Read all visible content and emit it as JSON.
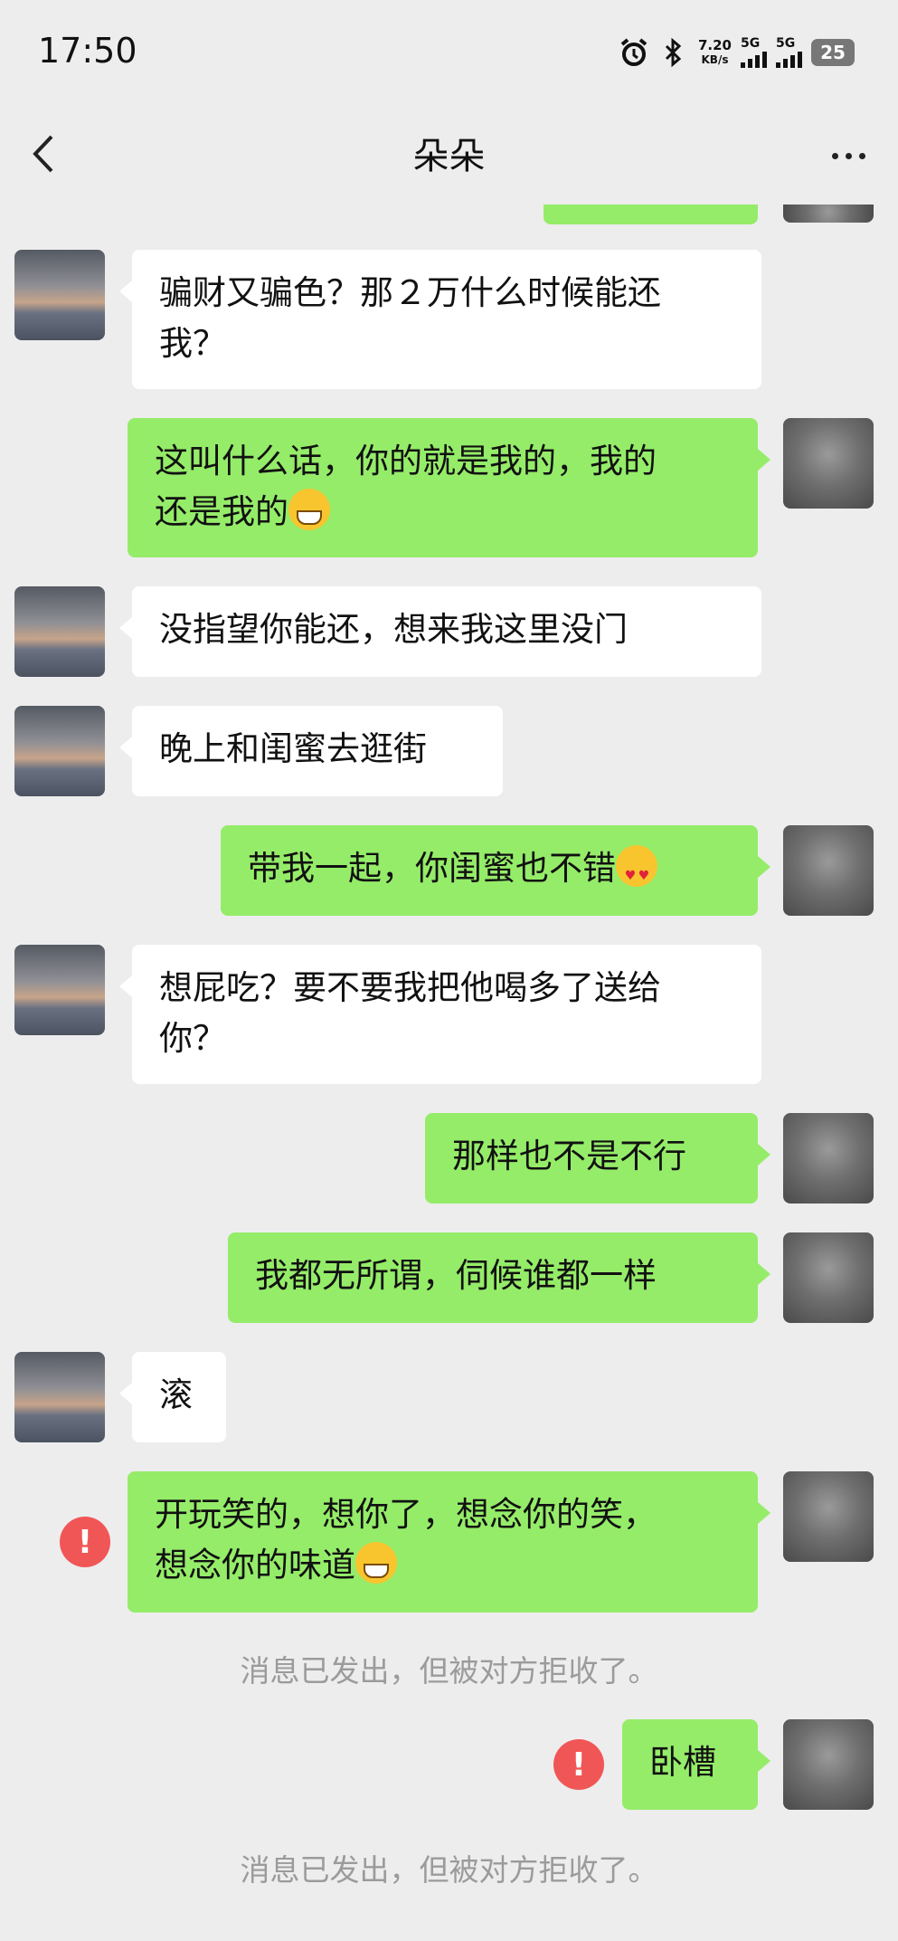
{
  "status_bar": {
    "time": "17:50",
    "net_speed_value": "7.20",
    "net_speed_unit": "KB/s",
    "signal1_label": "5G",
    "signal2_label": "5G",
    "battery": "25",
    "icons": [
      "alarm-icon",
      "bluetooth-icon",
      "signal-icon",
      "signal-icon",
      "battery-icon"
    ]
  },
  "header": {
    "title": "朵朵",
    "back_icon": "chevron-left-icon",
    "more_icon": "more-dots-icon"
  },
  "colors": {
    "background": "#ededed",
    "sent_bubble": "#95ec69",
    "received_bubble": "#ffffff",
    "error": "#f15656"
  },
  "messages": [
    {
      "from": "them",
      "lines": [
        "骗财又骗色？那２万什么时候能还",
        "我？"
      ]
    },
    {
      "from": "me",
      "lines": [
        "这叫什么话，你的就是我的，我的",
        "还是我的"
      ],
      "emoji": "grinning-face"
    },
    {
      "from": "them",
      "lines": [
        "没指望你能还，想来我这里没门"
      ]
    },
    {
      "from": "them",
      "lines": [
        "晚上和闺蜜去逛街"
      ]
    },
    {
      "from": "me",
      "lines": [
        "带我一起，你闺蜜也不错"
      ],
      "emoji": "heart-eyes-face"
    },
    {
      "from": "them",
      "lines": [
        "想屁吃？要不要我把他喝多了送给",
        "你？"
      ]
    },
    {
      "from": "me",
      "lines": [
        "那样也不是不行"
      ]
    },
    {
      "from": "me",
      "lines": [
        "我都无所谓，伺候谁都一样"
      ]
    },
    {
      "from": "them",
      "lines": [
        "滚"
      ]
    },
    {
      "from": "me",
      "lines": [
        "开玩笑的，想你了，想念你的笑，",
        "想念你的味道"
      ],
      "emoji": "grinning-face",
      "error": "!"
    },
    {
      "from": "me",
      "lines": [
        "卧槽"
      ],
      "error": "!"
    }
  ],
  "system_notes": [
    "消息已发出，但被对方拒收了。",
    "消息已发出，但被对方拒收了。"
  ]
}
